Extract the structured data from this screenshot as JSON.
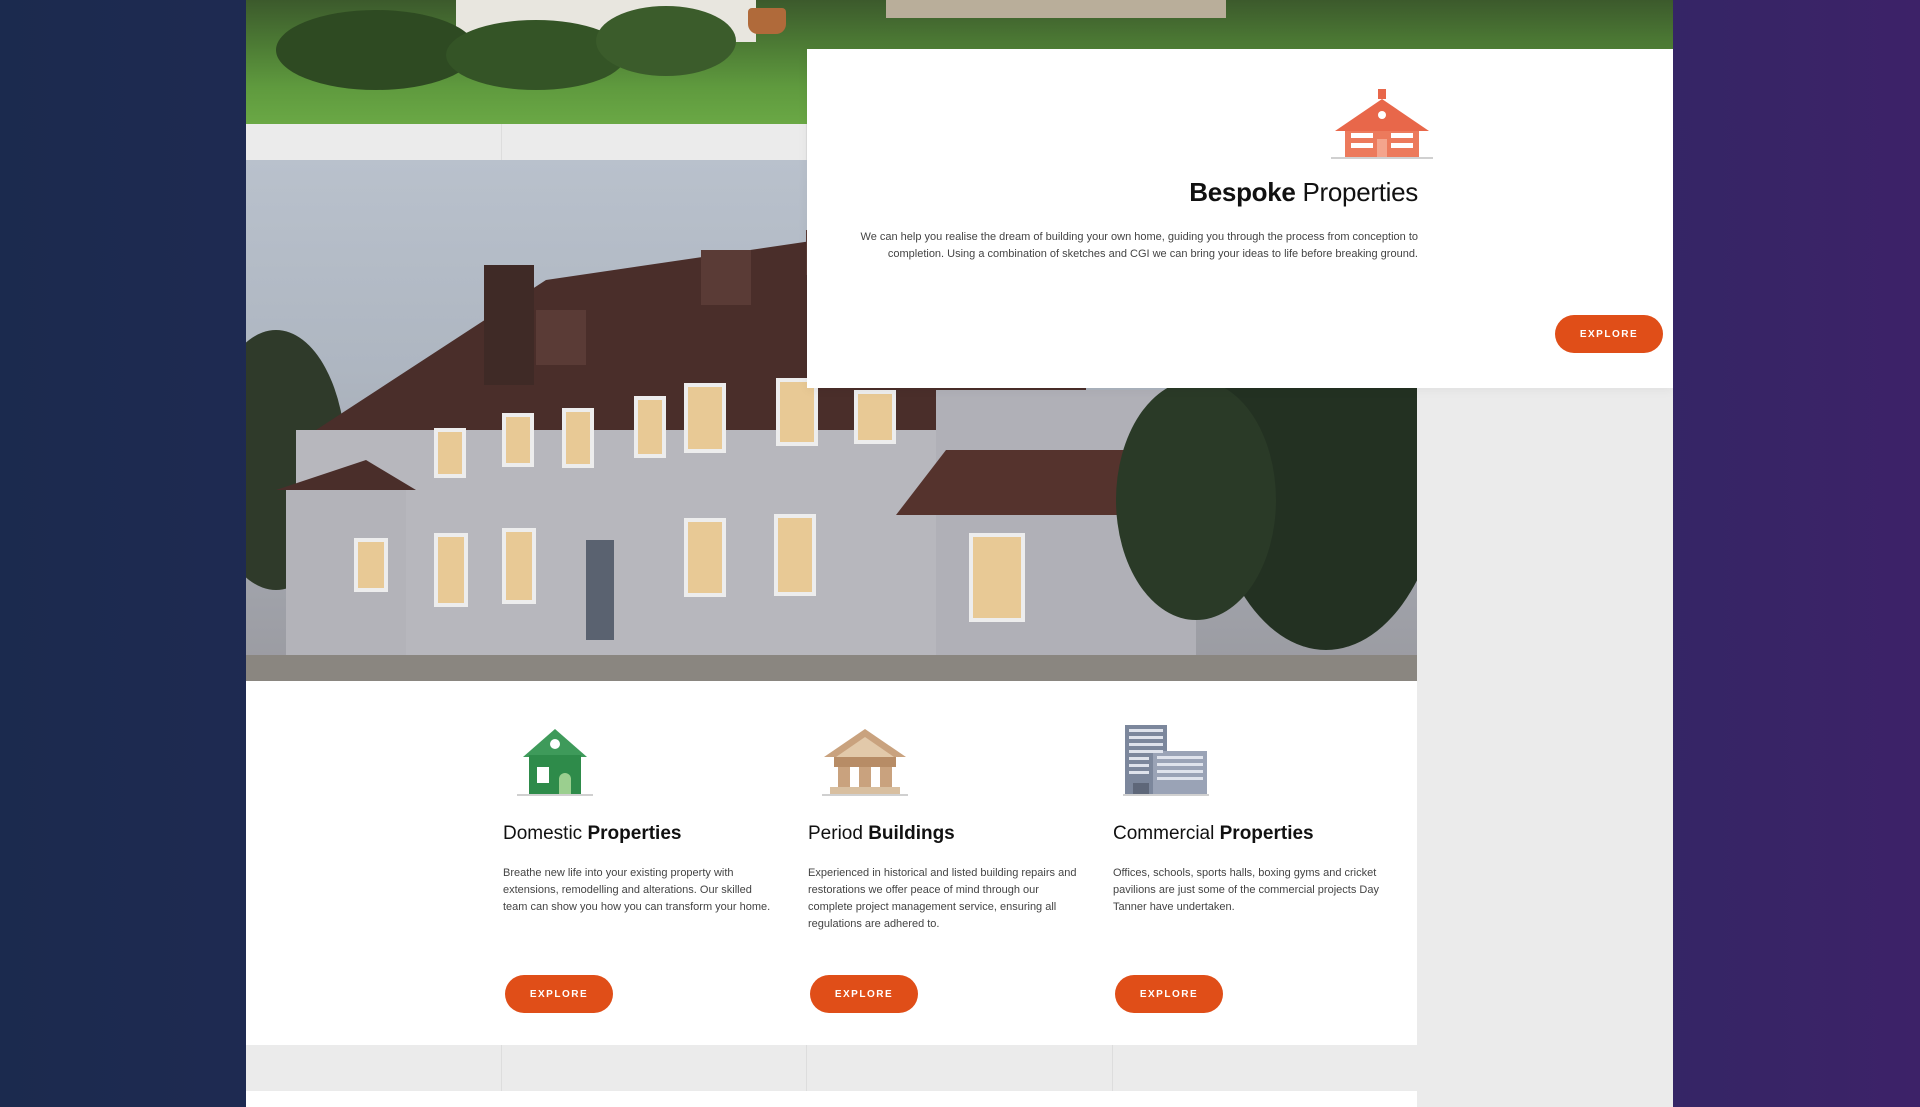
{
  "bespoke": {
    "title_bold": "Bespoke",
    "title_rest": " Properties",
    "description": "We can help you realise the dream of building your own home, guiding you through the process from conception to completion. Using a combination of sketches and CGI we can bring your ideas to life before breaking ground.",
    "button_label": "EXPLORE",
    "icon": "house-icon",
    "icon_color": "#e8674a"
  },
  "services": [
    {
      "title_lead": "Domestic ",
      "title_bold": "Properties",
      "description": "Breathe new life into your existing property with extensions, remodelling and alterations. Our skilled team can show you how you can transform your home.",
      "button_label": "EXPLORE",
      "icon": "house-icon",
      "icon_color": "#2e8b4a"
    },
    {
      "title_lead": "Period ",
      "title_bold": "Buildings",
      "description": "Experienced in historical and listed building repairs and restorations we offer peace of mind through our complete project management service, ensuring all regulations are adhered to.",
      "button_label": "EXPLORE",
      "icon": "pavilion-icon",
      "icon_color": "#c9a27e"
    },
    {
      "title_lead": "Commercial ",
      "title_bold": "Properties",
      "description": "Offices, schools, sports halls, boxing gyms and cricket pavilions are just some of the commercial projects Day Tanner have undertaken.",
      "button_label": "EXPLORE",
      "icon": "office-building-icon",
      "icon_color": "#8a94a8"
    }
  ],
  "colors": {
    "accent": "#e04e18",
    "background_left": "#1b2a4e",
    "background_right": "#3d2268",
    "page": "#ebebeb"
  }
}
